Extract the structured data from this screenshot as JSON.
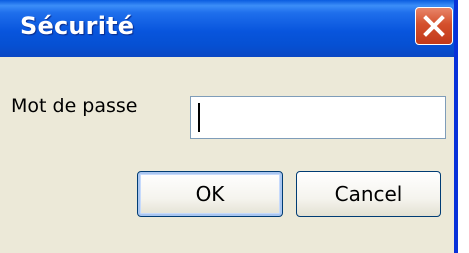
{
  "window": {
    "title": "Sécurité",
    "close_icon": "close-icon"
  },
  "form": {
    "password_label": "Mot de passe",
    "password_value": ""
  },
  "buttons": {
    "ok_label": "OK",
    "cancel_label": "Cancel"
  },
  "colors": {
    "titlebar": "#0855dd",
    "close_button": "#d4502c",
    "dialog_background": "#ece9d8",
    "input_border": "#7f9db9",
    "button_border": "#003c74"
  }
}
